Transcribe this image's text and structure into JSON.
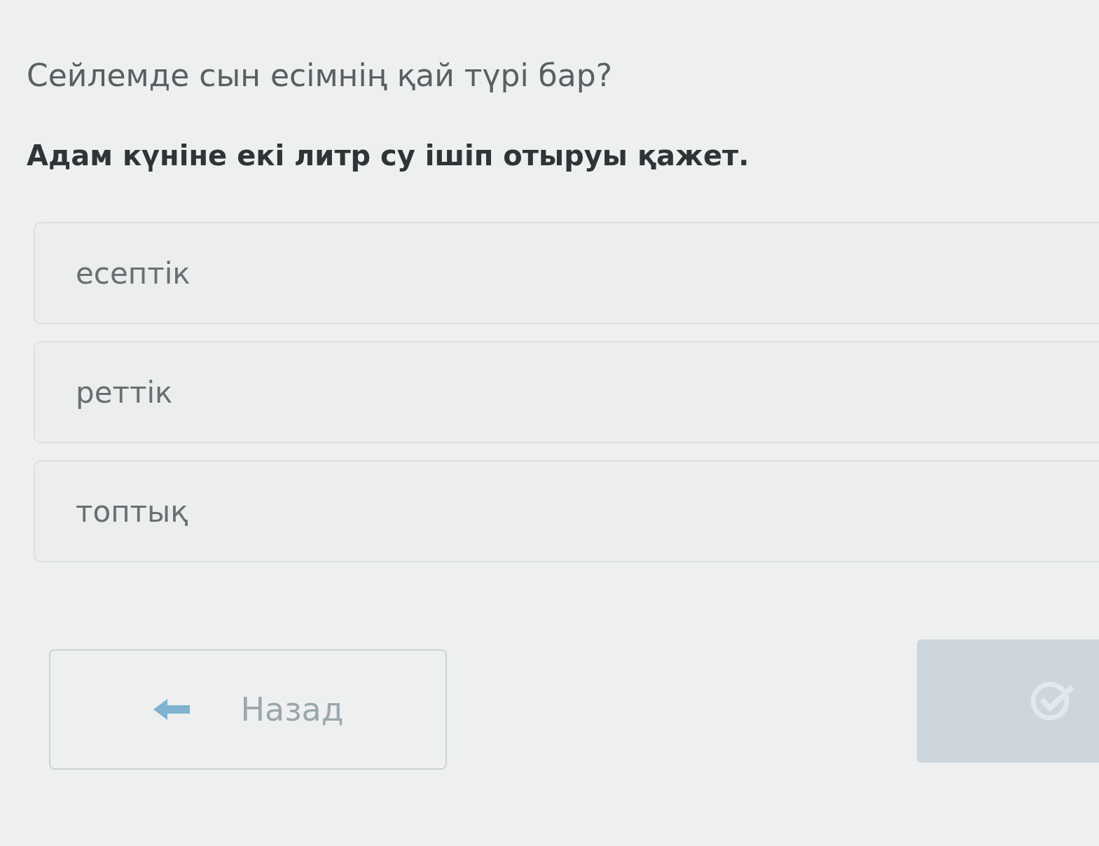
{
  "question": "Сейлемде сын есімнің қай түрі бар?",
  "sentence": "Адам күніне екі литр су ішіп отыруы қажет.",
  "options": [
    {
      "label": "есептік"
    },
    {
      "label": "реттік"
    },
    {
      "label": "топтық"
    }
  ],
  "back_button": {
    "label": "Назад"
  },
  "check_button": {
    "disabled": true
  }
}
